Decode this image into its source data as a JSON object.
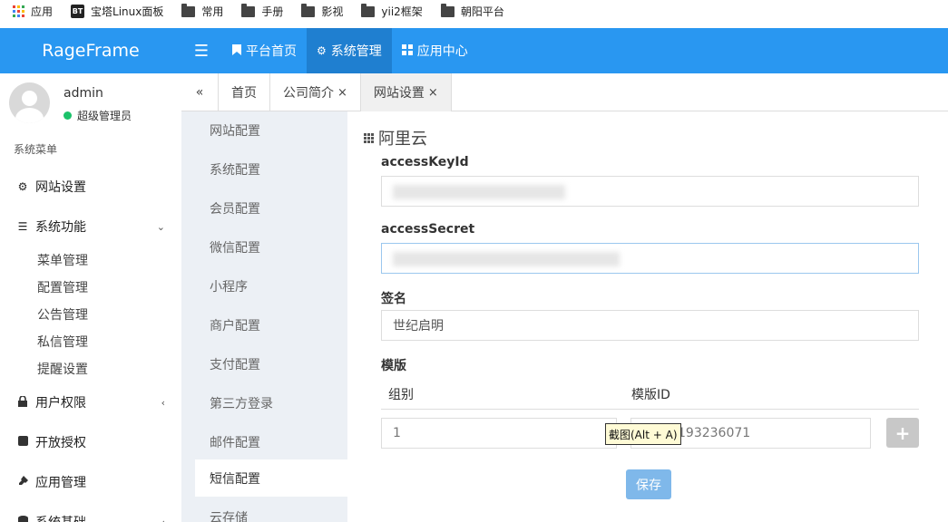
{
  "bookmarks": [
    {
      "label": "应用",
      "icon": "apps-grid-icon"
    },
    {
      "label": "宝塔Linux面板",
      "icon": "bt-icon"
    },
    {
      "label": "常用",
      "icon": "folder-icon"
    },
    {
      "label": "手册",
      "icon": "folder-icon"
    },
    {
      "label": "影视",
      "icon": "folder-icon"
    },
    {
      "label": "yii2框架",
      "icon": "folder-icon"
    },
    {
      "label": "朝阳平台",
      "icon": "folder-icon"
    }
  ],
  "bt_badge": "BT",
  "header": {
    "logo": "RageFrame",
    "nav": [
      {
        "label": "平台首页",
        "icon": "bookmark-icon"
      },
      {
        "label": "系统管理",
        "icon": "cogs-icon"
      },
      {
        "label": "应用中心",
        "icon": "grid-icon"
      }
    ]
  },
  "sidebar": {
    "user": {
      "name": "admin",
      "role": "超级管理员"
    },
    "menu_title": "系统菜单",
    "items": [
      {
        "label": "网站设置",
        "icon": "gear-icon"
      },
      {
        "label": "系统功能",
        "icon": "list-icon",
        "sub": [
          "菜单管理",
          "配置管理",
          "公告管理",
          "私信管理",
          "提醒设置"
        ]
      },
      {
        "label": "用户权限",
        "icon": "lock-icon"
      },
      {
        "label": "开放授权",
        "icon": "square-icon"
      },
      {
        "label": "应用管理",
        "icon": "plug-icon"
      },
      {
        "label": "系统基础",
        "icon": "database-icon"
      }
    ]
  },
  "tabs": [
    {
      "label": "首页"
    },
    {
      "label": "公司简介"
    },
    {
      "label": "网站设置"
    }
  ],
  "tab_close": "×",
  "submenu": [
    "网站配置",
    "系统配置",
    "会员配置",
    "微信配置",
    "小程序",
    "商户配置",
    "支付配置",
    "第三方登录",
    "邮件配置",
    "短信配置",
    "云存储"
  ],
  "content": {
    "title": "阿里云",
    "fields": {
      "access_key_label": "accessKeyId",
      "access_secret_label": "accessSecret",
      "sign_label": "签名",
      "sign_value": "世纪启明",
      "template_label": "模版"
    },
    "table": {
      "col_group": "组别",
      "col_template_id": "模版ID",
      "row_group": "1",
      "row_template_id": "_193236071"
    },
    "tooltip": "截图(Alt + A)",
    "add_button": "+",
    "save_button": "保存"
  },
  "colors": {
    "header": "#2997f1",
    "header_active": "#1f7fd0",
    "online": "#1bc26a",
    "save": "#7fb8ea"
  }
}
